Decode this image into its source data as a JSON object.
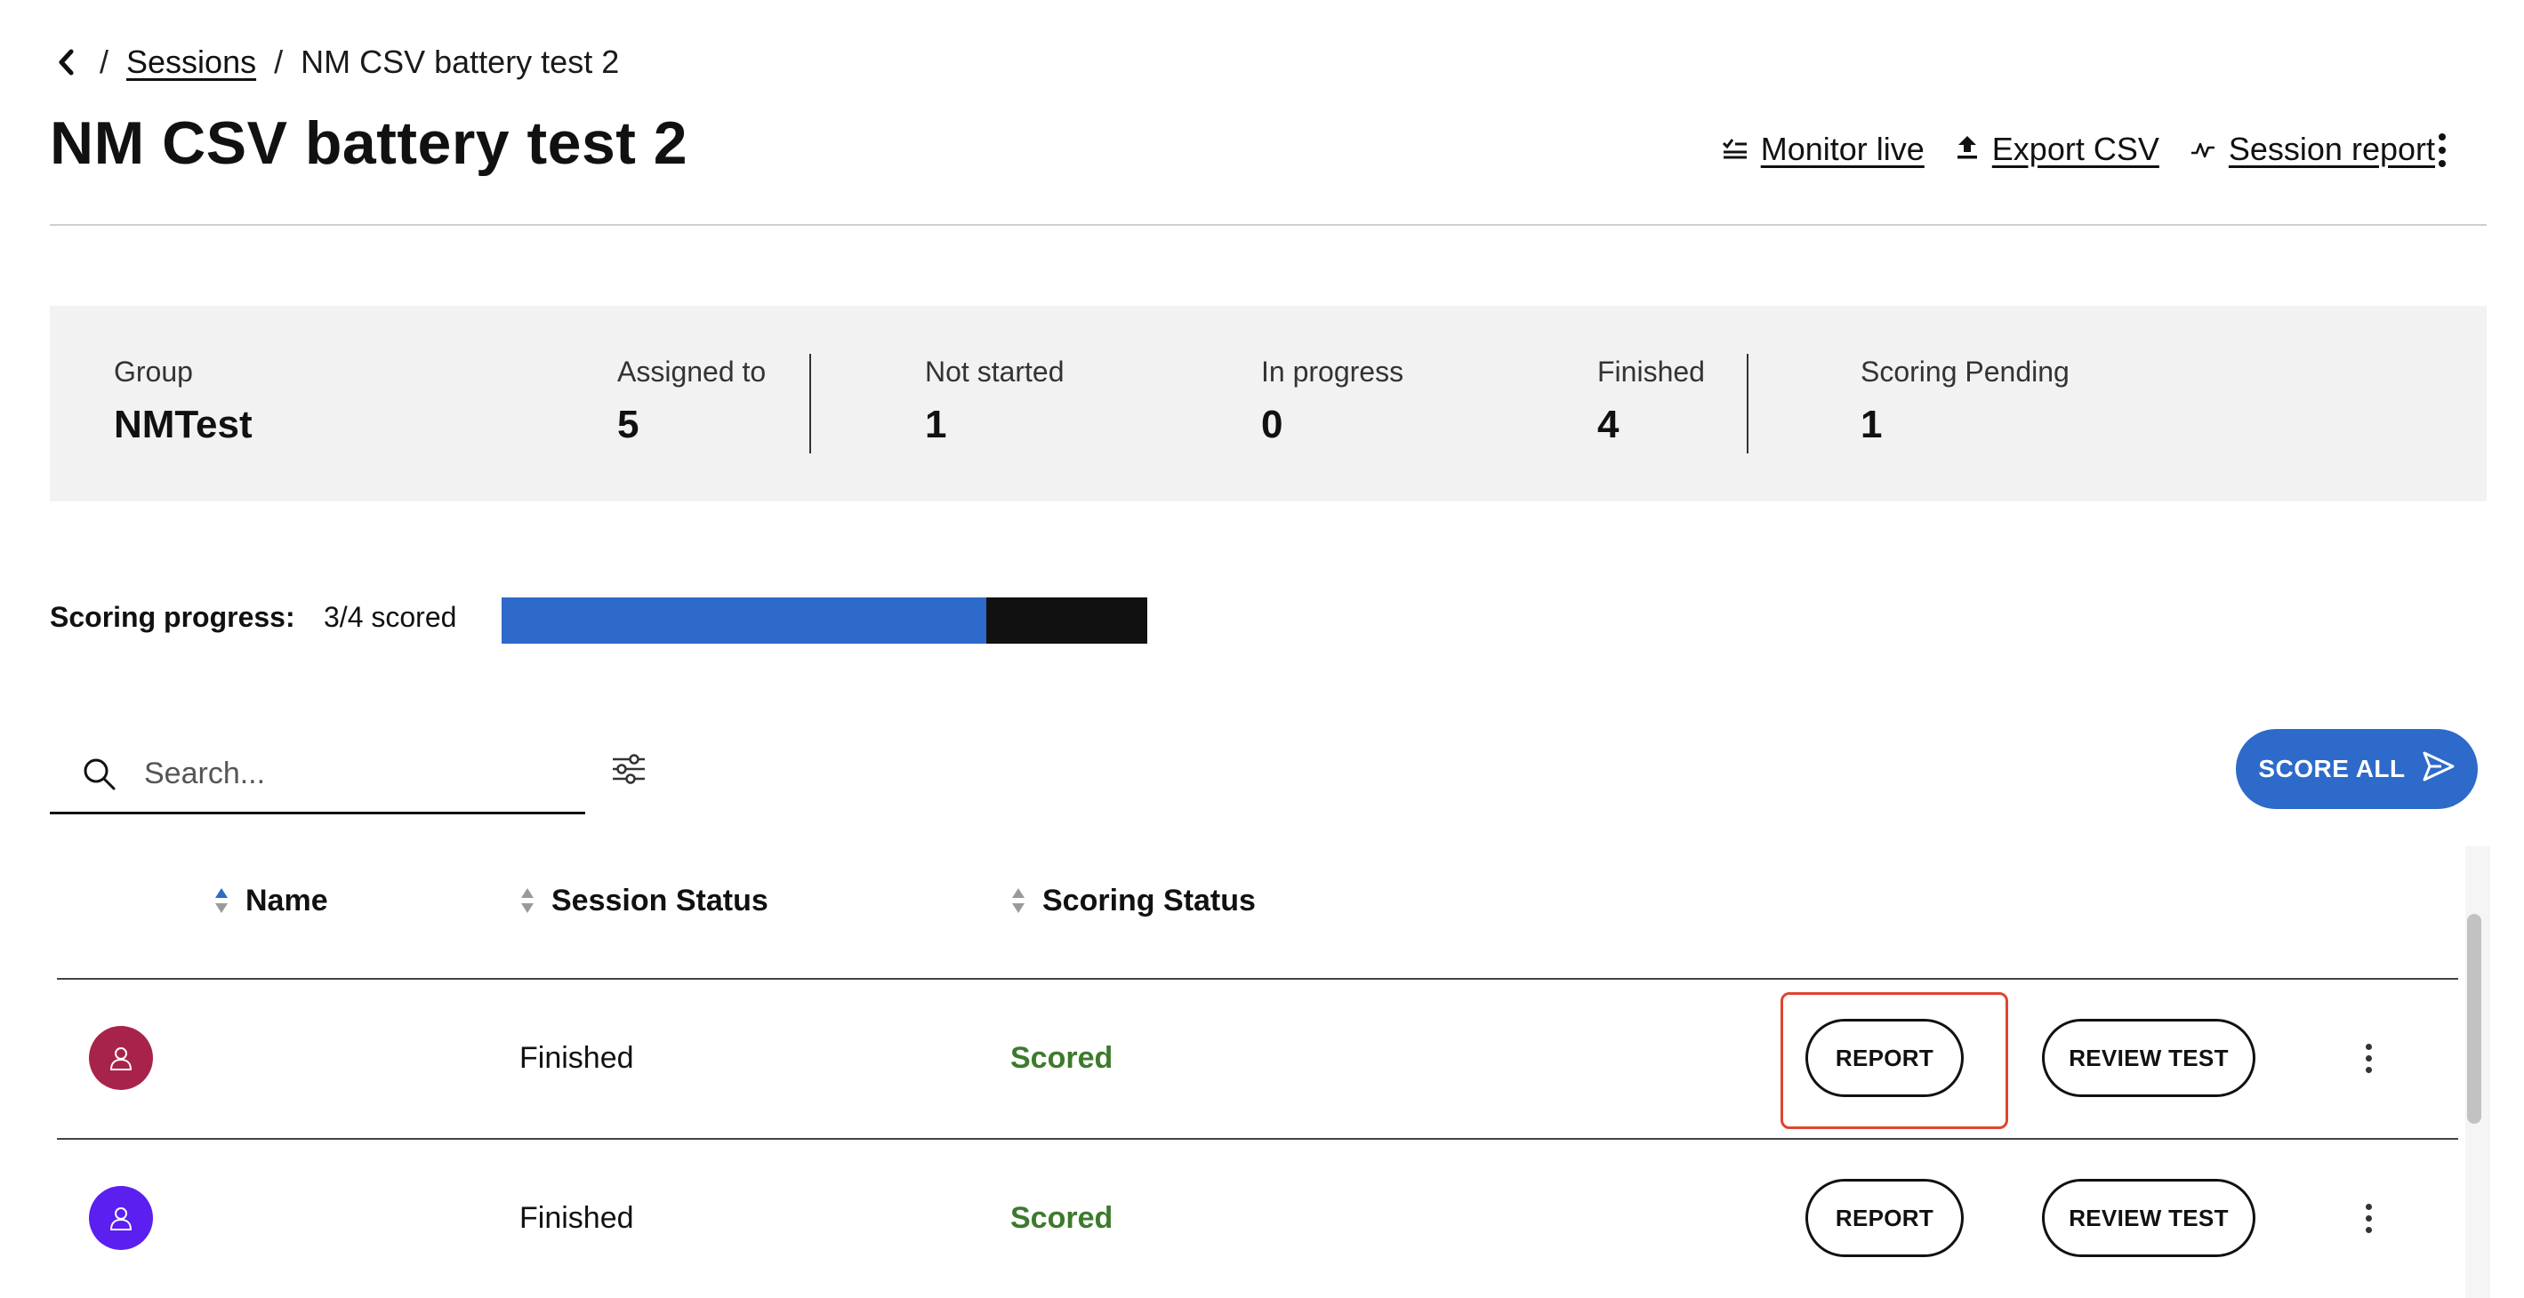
{
  "breadcrumb": {
    "back_icon": "chevron-left-icon",
    "separator": "/",
    "sessions_link": "Sessions",
    "current": "NM CSV battery test 2"
  },
  "header": {
    "title": "NM CSV battery test 2",
    "actions": {
      "monitor_live": "Monitor live",
      "export_csv": "Export CSV",
      "session_report": "Session report"
    }
  },
  "summary": {
    "group": {
      "label": "Group",
      "value": "NMTest"
    },
    "assigned": {
      "label": "Assigned to",
      "value": "5"
    },
    "not_started": {
      "label": "Not started",
      "value": "1"
    },
    "in_progress": {
      "label": "In progress",
      "value": "0"
    },
    "finished": {
      "label": "Finished",
      "value": "4"
    },
    "scoring_pending": {
      "label": "Scoring Pending",
      "value": "1"
    }
  },
  "scoring_progress": {
    "label": "Scoring progress:",
    "value_text": "3/4 scored",
    "fraction": 0.75,
    "fill_color": "#2d6ac9",
    "track_color": "#111111"
  },
  "search": {
    "placeholder": "Search..."
  },
  "score_all": {
    "label": "SCORE ALL"
  },
  "table": {
    "columns": {
      "name": "Name",
      "session_status": "Session Status",
      "scoring_status": "Scoring Status"
    },
    "rows": [
      {
        "avatar_color": "#a8234a",
        "name": "",
        "session_status": "Finished",
        "scoring_status": "Scored",
        "report_label": "REPORT",
        "review_label": "REVIEW TEST"
      },
      {
        "avatar_color": "#5b1ff0",
        "name": "",
        "session_status": "Finished",
        "scoring_status": "Scored",
        "report_label": "REPORT",
        "review_label": "REVIEW TEST"
      }
    ]
  },
  "colors": {
    "accent": "#2d6ac9",
    "scored": "#3d7a2c",
    "highlight": "#e0442e"
  }
}
